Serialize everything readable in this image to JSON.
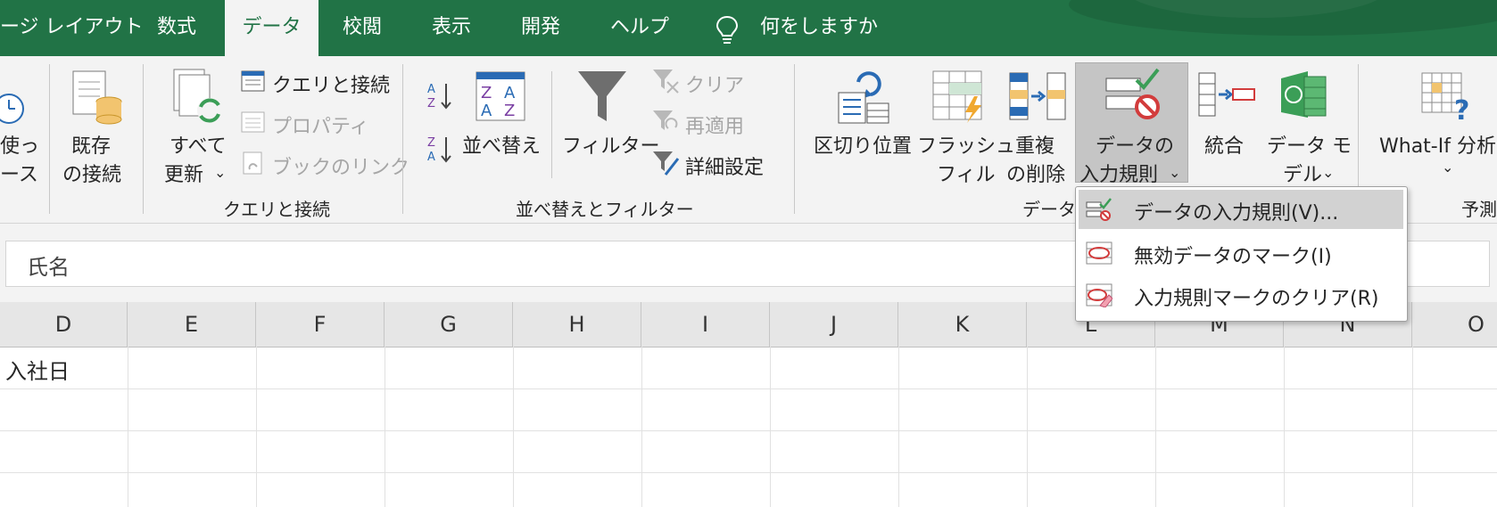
{
  "tabs": [
    {
      "label": "ージ レイアウト",
      "active": false
    },
    {
      "label": "数式",
      "active": false
    },
    {
      "label": "データ",
      "active": true
    },
    {
      "label": "校閲",
      "active": false
    },
    {
      "label": "表示",
      "active": false
    },
    {
      "label": "開発",
      "active": false
    },
    {
      "label": "ヘルプ",
      "active": false
    }
  ],
  "tellme": "何をしますか",
  "ribbon": {
    "partial_left": {
      "line1": "使っ",
      "line2": "ース"
    },
    "existing_conn": {
      "line1": "既存",
      "line2": "の接続"
    },
    "refresh_all": {
      "line1": "すべて",
      "line2": "更新"
    },
    "queries_conn": "クエリと接続",
    "properties": "プロパティ",
    "book_links": "ブックのリンク",
    "group_queries": "クエリと接続",
    "sort": "並べ替え",
    "filter": "フィルター",
    "clear": "クリア",
    "reapply": "再適用",
    "advanced": "詳細設定",
    "group_sort": "並べ替えとフィルター",
    "text_to_columns": "区切り位置",
    "flash_fill": {
      "line1": "フラッシュ",
      "line2": "フィル"
    },
    "remove_dup": {
      "line1": "重複",
      "line2": "の削除"
    },
    "data_validation": {
      "line1": "データの",
      "line2": "入力規則"
    },
    "consolidate": "統合",
    "data_model": {
      "line1": "データ モ",
      "line2": "デル"
    },
    "group_data_tools": "データ",
    "whatif": "What-If 分析",
    "group_forecast": "予測"
  },
  "namebox_value": "氏名",
  "columns": [
    "D",
    "E",
    "F",
    "G",
    "H",
    "I",
    "J",
    "K",
    "L",
    "M",
    "N",
    "O"
  ],
  "cells": {
    "D1": "入社日"
  },
  "menu": {
    "items": [
      {
        "label": "データの入力規則(V)...",
        "highlighted": true
      },
      {
        "label": "無効データのマーク(I)",
        "highlighted": false
      },
      {
        "label": "入力規則マークのクリア(R)",
        "highlighted": false
      }
    ]
  },
  "colors": {
    "excel_green": "#217346",
    "ribbon_bg": "#f3f3f3",
    "menu_highlight": "#d2d2d2"
  }
}
